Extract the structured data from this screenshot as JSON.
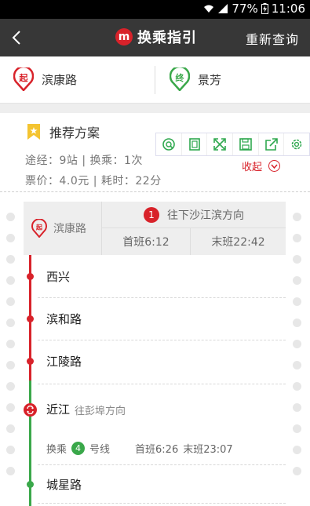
{
  "status": {
    "battery": "77%",
    "time": "11:06"
  },
  "header": {
    "title": "换乘指引",
    "requery": "重新查询",
    "logo": "m"
  },
  "route_ends": {
    "start": {
      "badge": "起",
      "name": "滨康路",
      "color": "#d8222a"
    },
    "end": {
      "badge": "终",
      "name": "景芳",
      "color": "#3aa84a"
    }
  },
  "plan": {
    "title": "推荐方案",
    "via": "途经：9站 | 换乘：1次",
    "fare": "票价：4.0元 | 耗时：22分",
    "collapse": "收起"
  },
  "toolbar_icons": [
    "search-icon",
    "clipboard-icon",
    "fullscreen-icon",
    "save-icon",
    "share-icon",
    "settings-icon"
  ],
  "segment1": {
    "station": "滨康路",
    "badge": "起",
    "line_number": "1",
    "direction": "往下沙江滨方向",
    "first_train": "首班6:12",
    "last_train": "末班22:42",
    "color": "#d8222a"
  },
  "stops": [
    "西兴",
    "滨和路",
    "江陵路"
  ],
  "transfer": {
    "station": "近江",
    "direction": "往彭埠方向",
    "label_pre": "换乘",
    "line_number": "4",
    "label_post": "号线",
    "first_train": "首班6:26",
    "last_train": "末班23:07",
    "color": "#3aa84a"
  },
  "stops2": [
    "城星路"
  ]
}
